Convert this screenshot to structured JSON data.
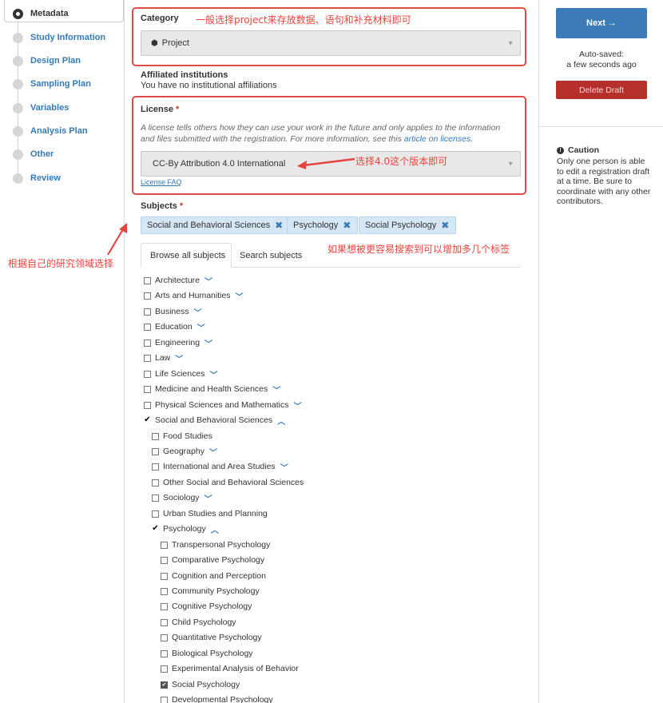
{
  "nav": {
    "items": [
      {
        "label": "Metadata",
        "active": true
      },
      {
        "label": "Study Information"
      },
      {
        "label": "Design Plan"
      },
      {
        "label": "Sampling Plan"
      },
      {
        "label": "Variables"
      },
      {
        "label": "Analysis Plan"
      },
      {
        "label": "Other"
      },
      {
        "label": "Review"
      }
    ]
  },
  "annotations": {
    "category_note": "一般选择project来存放数据、语句和补充材料即可",
    "license_note": "选择4.0这个版本即可",
    "subject_note": "根据自己的研究领域选择",
    "tags_note": "如果想被更容易搜索到可以增加多几个标签"
  },
  "category": {
    "title": "Category",
    "selected": "Project",
    "icon": "cube-icon"
  },
  "affiliated": {
    "title": "Affiliated institutions",
    "text": "You have no institutional affiliations"
  },
  "license": {
    "title": "License",
    "required_mark": "*",
    "desc_line1": "A license tells others how they can use your work in the future and only applies to the information",
    "desc_line2": "and files submitted with the registration. For more information, see this",
    "desc_link": "article on licenses",
    "desc_end": ".",
    "selected": "CC-By Attribution 4.0 International",
    "faq": "License FAQ"
  },
  "subjects": {
    "title": "Subjects",
    "required_mark": "*",
    "tags": [
      "Social and Behavioral Sciences",
      "Psychology",
      "Social Psychology"
    ],
    "tabs": [
      "Browse all subjects",
      "Search subjects"
    ],
    "tree": [
      {
        "label": "Architecture",
        "state": "none",
        "chevron": "down"
      },
      {
        "label": "Arts and Humanities",
        "state": "none",
        "chevron": "down"
      },
      {
        "label": "Business",
        "state": "none",
        "chevron": "down"
      },
      {
        "label": "Education",
        "state": "none",
        "chevron": "down"
      },
      {
        "label": "Engineering",
        "state": "none",
        "chevron": "down"
      },
      {
        "label": "Law",
        "state": "none",
        "chevron": "down"
      },
      {
        "label": "Life Sciences",
        "state": "none",
        "chevron": "down"
      },
      {
        "label": "Medicine and Health Sciences",
        "state": "none",
        "chevron": "down"
      },
      {
        "label": "Physical Sciences and Mathematics",
        "state": "none",
        "chevron": "down"
      },
      {
        "label": "Social and Behavioral Sciences",
        "state": "tick",
        "chevron": "up"
      },
      {
        "label": "Food Studies",
        "state": "none"
      },
      {
        "label": "Geography",
        "state": "none",
        "chevron": "down"
      },
      {
        "label": "International and Area Studies",
        "state": "none",
        "chevron": "down"
      },
      {
        "label": "Other Social and Behavioral Sciences",
        "state": "none"
      },
      {
        "label": "Sociology",
        "state": "none",
        "chevron": "down"
      },
      {
        "label": "Urban Studies and Planning",
        "state": "none"
      },
      {
        "label": "Psychology",
        "state": "tick",
        "chevron": "up"
      },
      {
        "label": "Transpersonal Psychology",
        "state": "none"
      },
      {
        "label": "Comparative Psychology",
        "state": "none"
      },
      {
        "label": "Cognition and Perception",
        "state": "none"
      },
      {
        "label": "Community Psychology",
        "state": "none"
      },
      {
        "label": "Cognitive Psychology",
        "state": "none"
      },
      {
        "label": "Child Psychology",
        "state": "none"
      },
      {
        "label": "Quantitative Psychology",
        "state": "none"
      },
      {
        "label": "Biological Psychology",
        "state": "none"
      },
      {
        "label": "Experimental Analysis of Behavior",
        "state": "none"
      },
      {
        "label": "Social Psychology",
        "state": "checked"
      },
      {
        "label": "Developmental Psychology",
        "state": "none"
      }
    ]
  },
  "sidebar": {
    "next_label": "Next →",
    "autosave_line1": "Auto-saved:",
    "autosave_line2": "a few seconds ago",
    "delete_label": "Delete Draft",
    "caution_title": "Caution",
    "caution_body": "Only one person is able to edit a registration draft at a time. Be sure to coordinate with any other contributors."
  },
  "colors": {
    "accent": "#337ab7",
    "annotation": "#e24a4a",
    "danger": "#b5302a",
    "primary": "#3c7ab8",
    "tag_bg": "#d5e6f4"
  }
}
